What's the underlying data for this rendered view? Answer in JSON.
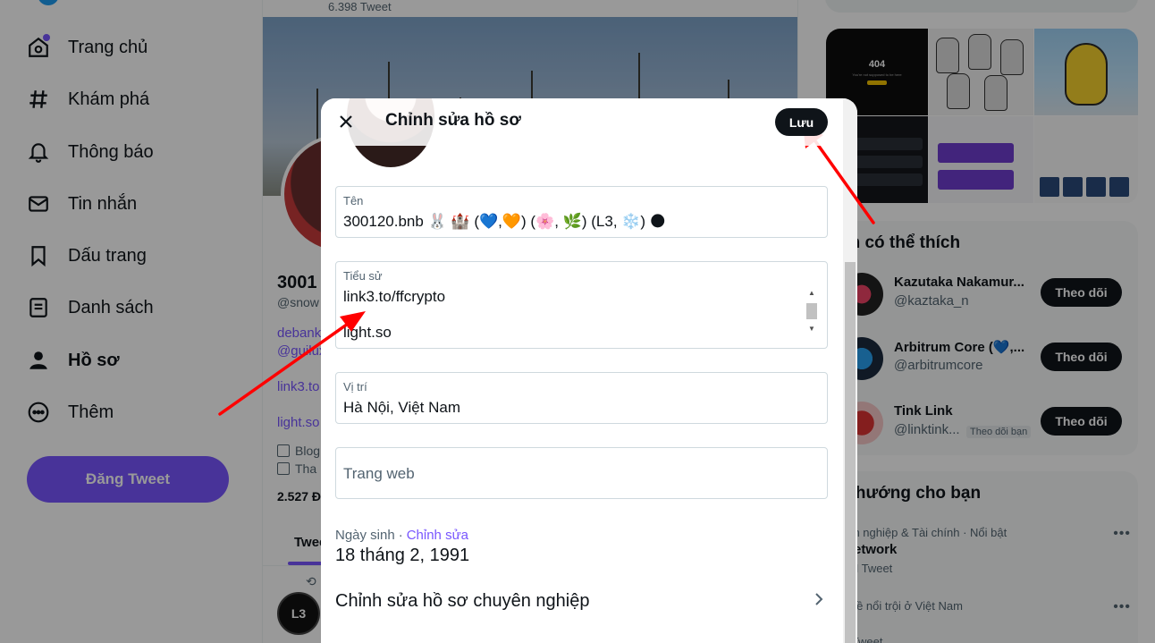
{
  "nav": {
    "items": [
      {
        "label": "Trang chủ",
        "icon": "home-icon"
      },
      {
        "label": "Khám phá",
        "icon": "hashtag-icon"
      },
      {
        "label": "Thông báo",
        "icon": "bell-icon"
      },
      {
        "label": "Tin nhắn",
        "icon": "mail-icon"
      },
      {
        "label": "Dấu trang",
        "icon": "bookmark-icon"
      },
      {
        "label": "Danh sách",
        "icon": "list-icon"
      },
      {
        "label": "Hồ sơ",
        "icon": "person-icon"
      },
      {
        "label": "Thêm",
        "icon": "more-circle-icon"
      }
    ],
    "tweet_button": "Đăng Tweet"
  },
  "profile": {
    "tweet_count": "6.398 Tweet",
    "name_partial": "3001",
    "handle_partial": "@snow",
    "bio_line1": "debank",
    "bio_line2": "@guilux",
    "link1": "link3.to",
    "link2": "light.so",
    "meta1": "Blog",
    "meta2": "Tha",
    "follow_partial": "2.527 Đ",
    "tab": "Twee",
    "avatar_text": "L3"
  },
  "right": {
    "media": {
      "m1_big": "404",
      "m1_small": "You're not supposed to be here"
    },
    "who_to_follow": {
      "title": "ạn có thể thích",
      "accounts": [
        {
          "name": "Kazutaka Nakamur...",
          "handle": "@kaztaka_n",
          "button": "Theo dõi"
        },
        {
          "name": "Arbitrum Core (💙,...",
          "handle": "@arbitrumcore",
          "button": "Theo dõi"
        },
        {
          "name": "Tink Link",
          "handle": "@linktink...",
          "badge": "Theo dõi bạn",
          "button": "Theo dõi"
        }
      ]
    },
    "trends": {
      "title": "u hướng cho bạn",
      "items": [
        {
          "context": "anh nghiệp & Tài chính · Nổi bật",
          "name": "iNetwork",
          "count": "1 N Tweet"
        },
        {
          "context": "ủ đề nổi trội ở Việt Nam",
          "name": "en",
          "count": "N Tweet"
        }
      ]
    }
  },
  "modal": {
    "title": "Chỉnh sửa hồ sơ",
    "save": "Lưu",
    "name_label": "Tên",
    "name_value": "300120.bnb 🐰 🏰 (💙,🧡) (🌸, 🌿) (L3, ❄️) 🌑",
    "bio_label": "Tiểu sử",
    "bio_line1": "link3.to/ffcrypto",
    "bio_line2": "light.so",
    "location_label": "Vị trí",
    "location_value": "Hà Nội, Việt Nam",
    "website_placeholder": "Trang web",
    "birth_label": "Ngày sinh",
    "birth_sep": "·",
    "birth_edit": "Chỉnh sửa",
    "birth_value": "18 tháng 2, 1991",
    "pro_label": "Chỉnh sửa hồ sơ chuyên nghiệp"
  },
  "colors": {
    "accent": "#7856ff",
    "annotation": "#ff0000",
    "dark": "#0f1419"
  }
}
